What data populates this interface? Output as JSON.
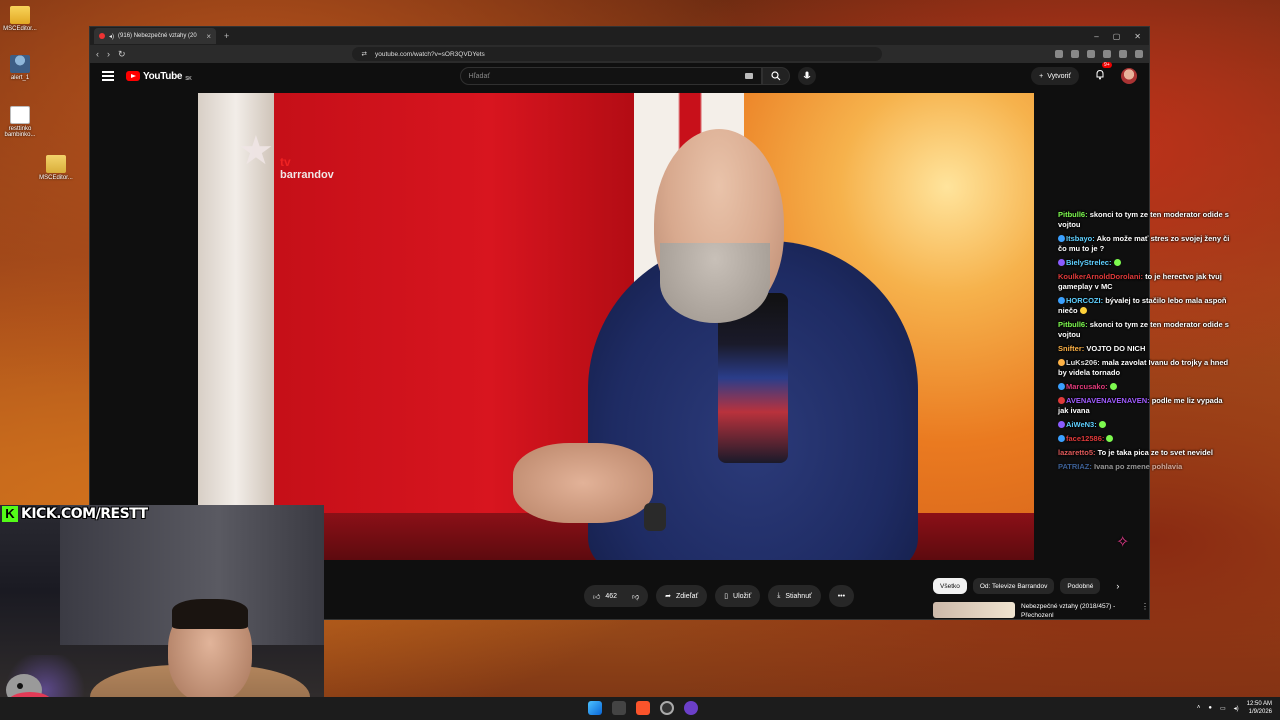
{
  "desktop": {
    "icons": [
      {
        "label": "MSCEditor...",
        "kind": "folder"
      },
      {
        "label": "alert_1",
        "kind": "person"
      },
      {
        "label": "resttinko bambinko...",
        "kind": "doc"
      },
      {
        "label": "MSCEditor...",
        "kind": "folder2"
      }
    ]
  },
  "browser": {
    "tab_title": "(916) Nebezpečné vztahy (20",
    "url": "youtube.com/watch?v=sOR3QVDYets"
  },
  "youtube": {
    "logo_text": "YouTube",
    "logo_sup": "SK",
    "search_placeholder": "Hľadať",
    "create_label": "Vytvoriť",
    "notif_count": "9+",
    "video_watermark_brand": "tv",
    "video_watermark_name": "barrandov",
    "actions": {
      "likes": "462",
      "share": "Zdieľať",
      "save": "Uložiť",
      "download": "Stiahnuť"
    },
    "chips": [
      "Všetko",
      "Od: Televize Barrandov",
      "Podobné"
    ],
    "recommendation_title": "Nebezpečné vztahy (2018/457) - Přechozenl"
  },
  "chat": {
    "messages": [
      {
        "user": "Pitbull6:",
        "user_color": "#7dfa4f",
        "text": "skonci to tym ze ten moderator odide s vojtou",
        "icon_color": ""
      },
      {
        "user": "Itsbayo:",
        "user_color": "#5fd0ff",
        "text": "Ako može mať stres zo svojej ženy či čo mu to je ?",
        "icon_color": "#3aa0ff"
      },
      {
        "user": "BielyStrelec:",
        "user_color": "#5fd0ff",
        "text": "",
        "icon_color": "#8a5cff"
      },
      {
        "user": "KoulkerArnoldDorolani:",
        "user_color": "#e03a3a",
        "text": "to je herectvo jak tvuj gameplay v MC",
        "icon_color": ""
      },
      {
        "user": "HORCOZI:",
        "user_color": "#5fd0ff",
        "text": "bývalej to stačilo lebo mala aspoň niečo",
        "icon_color": "#3aa0ff"
      },
      {
        "user": "Pitbull6:",
        "user_color": "#7dfa4f",
        "text": "skonci to tym ze ten moderator odide s vojtou",
        "icon_color": ""
      },
      {
        "user": "Snifter:",
        "user_color": "#ffb347",
        "text": "VOJTO DO NICH",
        "icon_color": ""
      },
      {
        "user": "LuKs206:",
        "user_color": "#dddddd",
        "text": "mala zavolat Ivanu do trojky a hned by videla tornado",
        "icon_color": "#ffb347"
      },
      {
        "user": "Marcusako:",
        "user_color": "#e03a7a",
        "text": "",
        "icon_color": "#3aa0ff"
      },
      {
        "user": "AVENAVENAVENAVEN:",
        "user_color": "#a05cff",
        "text": "podle me liz vypada jak ivana",
        "icon_color": "#e03a3a"
      },
      {
        "user": "AiWeN3:",
        "user_color": "#5fd0ff",
        "text": "",
        "icon_color": "#8a5cff"
      },
      {
        "user": "face12586:",
        "user_color": "#e03a3a",
        "text": "",
        "icon_color": "#3aa0ff"
      },
      {
        "user": "lazaretto5:",
        "user_color": "#e05a5a",
        "text": "To je taka pica ze to svet nevidel",
        "icon_color": ""
      },
      {
        "user": "PATRIAZ:",
        "user_color": "#5fa0ff",
        "text": "Ivana po zmene pohlavia",
        "icon_color": ""
      }
    ]
  },
  "overlay": {
    "kick_url": "KICK.COM/RESTT",
    "kick_brand_color": "#53fc18"
  },
  "taskbar": {
    "time": "12:50 AM",
    "date": "1/9/2026"
  }
}
